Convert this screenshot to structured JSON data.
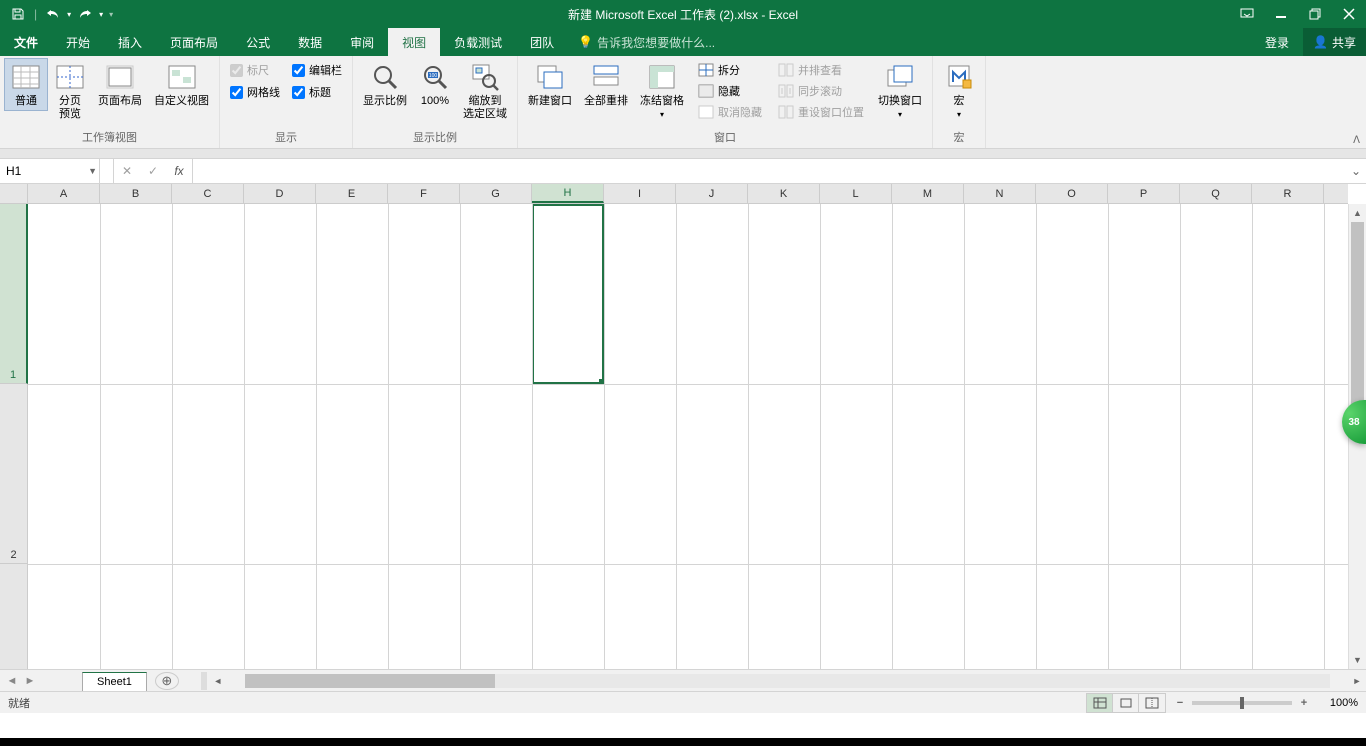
{
  "title": "新建 Microsoft Excel 工作表 (2).xlsx - Excel",
  "qat": {
    "save": "保存",
    "undo": "撤消",
    "redo": "恢复"
  },
  "tabs": {
    "file": "文件",
    "home": "开始",
    "insert": "插入",
    "pageLayout": "页面布局",
    "formulas": "公式",
    "data": "数据",
    "review": "审阅",
    "view": "视图",
    "loadTest": "负载测试",
    "team": "团队"
  },
  "tellme": "告诉我您想要做什么...",
  "login": "登录",
  "share": "共享",
  "ribbon": {
    "g1": {
      "label": "工作簿视图",
      "normal": "普通",
      "pageBreak": "分页\n预览",
      "pageLayout": "页面布局",
      "custom": "自定义视图"
    },
    "g2": {
      "label": "显示",
      "ruler": "标尺",
      "formulaBar": "编辑栏",
      "gridlines": "网格线",
      "headings": "标题"
    },
    "g3": {
      "label": "显示比例",
      "zoom": "显示比例",
      "hundred": "100%",
      "zoomSel": "缩放到\n选定区域"
    },
    "g4": {
      "label": "窗口",
      "newWin": "新建窗口",
      "arrange": "全部重排",
      "freeze": "冻结窗格",
      "split": "拆分",
      "hide": "隐藏",
      "unhide": "取消隐藏",
      "sideBySide": "并排查看",
      "syncScroll": "同步滚动",
      "resetPos": "重设窗口位置",
      "switchWin": "切换窗口"
    },
    "g5": {
      "label": "宏",
      "macros": "宏"
    }
  },
  "nameBox": "H1",
  "columns": [
    "A",
    "B",
    "C",
    "D",
    "E",
    "F",
    "G",
    "H",
    "I",
    "J",
    "K",
    "L",
    "M",
    "N",
    "O",
    "P",
    "Q",
    "R"
  ],
  "rows": [
    "1",
    "2"
  ],
  "selectedCol": "H",
  "selectedRow": "1",
  "sheet": "Sheet1",
  "status": "就绪",
  "zoom": "100%",
  "badge": "38"
}
